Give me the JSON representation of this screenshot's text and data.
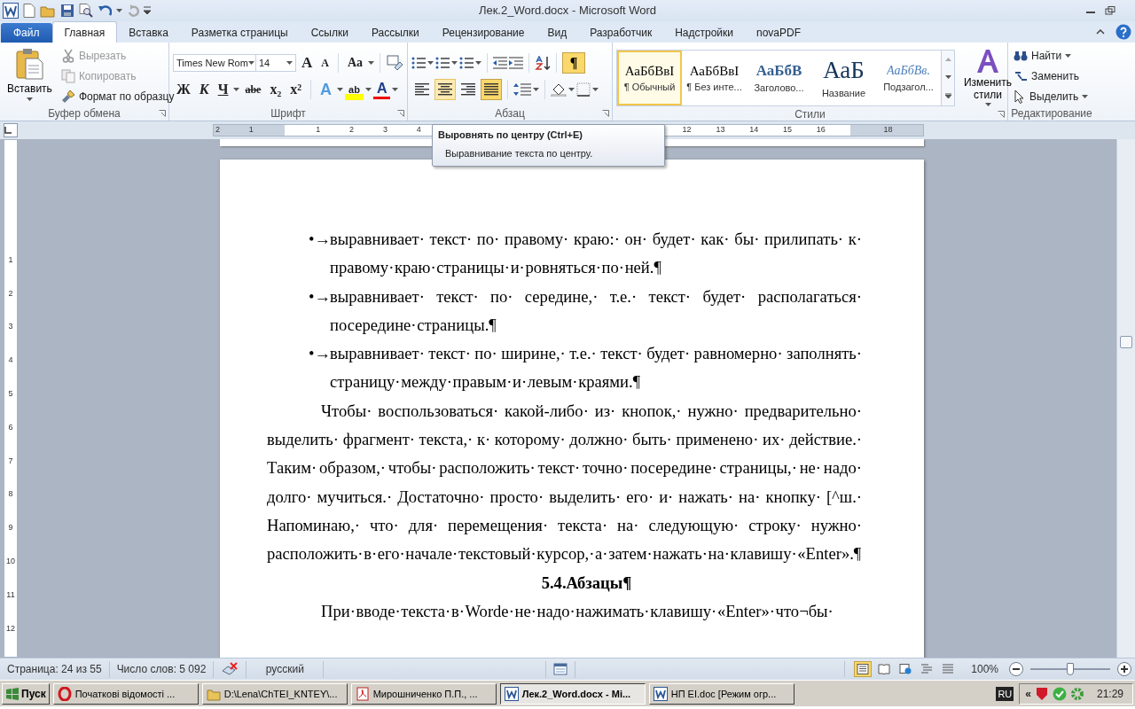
{
  "window": {
    "title": "Лек.2_Word.docx  -  Microsoft Word"
  },
  "tabs": [
    {
      "label": "Файл",
      "kind": "file",
      "selected": false
    },
    {
      "label": "Главная",
      "kind": "tab",
      "selected": true
    },
    {
      "label": "Вставка",
      "kind": "tab",
      "selected": false
    },
    {
      "label": "Разметка страницы",
      "kind": "tab",
      "selected": false
    },
    {
      "label": "Ссылки",
      "kind": "tab",
      "selected": false
    },
    {
      "label": "Рассылки",
      "kind": "tab",
      "selected": false
    },
    {
      "label": "Рецензирование",
      "kind": "tab",
      "selected": false
    },
    {
      "label": "Вид",
      "kind": "tab",
      "selected": false
    },
    {
      "label": "Разработчик",
      "kind": "tab",
      "selected": false
    },
    {
      "label": "Надстройки",
      "kind": "tab",
      "selected": false
    },
    {
      "label": "novaPDF",
      "kind": "tab",
      "selected": false
    }
  ],
  "clipboard": {
    "label": "Буфер обмена",
    "paste": "Вставить",
    "items": [
      {
        "kind": "cut",
        "label": "Вырезать",
        "disabled": true
      },
      {
        "kind": "copy",
        "label": "Копировать",
        "disabled": true
      },
      {
        "kind": "brush",
        "label": "Формат по образцу",
        "disabled": false
      }
    ]
  },
  "font": {
    "label": "Шрифт",
    "name": "Times New Rom",
    "size": "14",
    "grow": "A",
    "shrink": "A",
    "case": "Aa",
    "styles": [
      {
        "kind": "bold",
        "label": "Ж"
      },
      {
        "kind": "italic",
        "label": "К"
      },
      {
        "kind": "underline",
        "label": "Ч"
      },
      {
        "kind": "strike",
        "label": "abe"
      },
      {
        "kind": "sub",
        "label": "x₂"
      },
      {
        "kind": "sup",
        "label": "x²"
      }
    ],
    "effects": [
      {
        "kind": "text-effect",
        "label": "A"
      },
      {
        "kind": "highlight",
        "label": "ab"
      },
      {
        "kind": "font-color",
        "label": "A"
      }
    ]
  },
  "paragraph": {
    "label": "Абзац",
    "show_marks": {
      "label": "¶",
      "selected": true
    },
    "alignment": [
      {
        "kind": "left",
        "selected": false,
        "hovered": false
      },
      {
        "kind": "center",
        "selected": false,
        "hovered": true
      },
      {
        "kind": "right",
        "selected": false,
        "hovered": false
      },
      {
        "kind": "justify",
        "selected": true,
        "hovered": false
      }
    ]
  },
  "styles": {
    "label": "Стили",
    "items": [
      {
        "sample": "АаБбВвI",
        "label": "¶ Обычный",
        "kind": "normal",
        "selected": true
      },
      {
        "sample": "АаБбВвI",
        "label": "¶ Без инте...",
        "kind": "normal",
        "selected": false
      },
      {
        "sample": "АаБбВ",
        "label": "Заголово...",
        "kind": "heading",
        "selected": false
      },
      {
        "sample": "АаБ",
        "label": "Название",
        "kind": "title",
        "selected": false
      },
      {
        "sample": "АаБбВв.",
        "label": "Подзагол...",
        "kind": "subtitle",
        "selected": false
      }
    ],
    "change": "Изменить стили"
  },
  "editing": {
    "label": "Редактирование",
    "items": [
      {
        "kind": "find",
        "label": "Найти"
      },
      {
        "kind": "replace",
        "label": "Заменить"
      },
      {
        "kind": "select",
        "label": "Выделить"
      }
    ]
  },
  "ruler": {
    "labels": [
      "2",
      "1",
      "1",
      "2",
      "3",
      "4",
      "12",
      "13",
      "14",
      "15",
      "16",
      "18"
    ],
    "vertical_labels": [
      "1",
      "2",
      "3",
      "4",
      "5",
      "6",
      "7",
      "8",
      "9",
      "10",
      "11",
      "12"
    ]
  },
  "tooltip": {
    "title": "Выровнять по центру (Ctrl+E)",
    "body": "Выравнивание текста по центру."
  },
  "document": {
    "paragraphs": [
      {
        "kind": "bullet",
        "marker": "•→",
        "text": "выравнивает· текст· по· правому· краю:· он· будет· как· бы· прилипать· к· правому· краю· страницы· и· ровняться· по· ней.¶"
      },
      {
        "kind": "bullet",
        "marker": "•→",
        "text": "выравнивает· текст· по· середине,· т.е.· текст· будет· располагаться· посередине· страницы.¶"
      },
      {
        "kind": "bullet",
        "marker": "•→",
        "text": "выравнивает· текст· по· ширине,· т.е.· текст· будет· равномерно· заполнять· страницу· между· правым· и· левым· краями.¶"
      },
      {
        "kind": "body",
        "text": "Чтобы· воспользоваться· какой-либо· из· кнопок,· нужно· предварительно· выделить· фрагмент· текста,· к· которому· должно· быть· применено· их· действие.· Таким· образом,· чтобы· расположить· текст· точно· посередине· страницы,· не· надо· долго· мучиться.· Достаточно· просто· выделить· его· и· нажать· на· кнопку· [^ш.· Напоминаю,· что· для· перемещения· текста· на· следующую· строку· нужно· расположить· в· его· начале· текстовый· курсор,· а· затем· нажать· на· клавишу· «Enter».¶"
      },
      {
        "kind": "heading",
        "text": "5.4.Абзацы¶"
      },
      {
        "kind": "body",
        "text": "При· вводе· текста· в· Worde· не· надо· нажимать· клавишу· «Enter»· что¬бы·"
      }
    ]
  },
  "status_bar": {
    "page": "Страница: 24 из 55",
    "words": "Число слов: 5 092",
    "language": "русский",
    "zoom": "100%",
    "level": 0.5,
    "views": [
      {
        "kind": "print",
        "selected": true
      },
      {
        "kind": "read",
        "selected": false
      },
      {
        "kind": "web",
        "selected": false
      },
      {
        "kind": "outline",
        "selected": false
      },
      {
        "kind": "draft",
        "selected": false
      }
    ]
  },
  "taskbar": {
    "start": "Пуск",
    "tasks": [
      {
        "kind": "browser",
        "label": "Початкові відомості ...",
        "selected": false
      },
      {
        "kind": "folder",
        "label": "D:\\Lena\\ChTEI_KNTEY\\...",
        "selected": false
      },
      {
        "kind": "pdf",
        "label": "Мирошниченко П.П., ...",
        "selected": false
      },
      {
        "kind": "word",
        "label": "Лек.2_Word.docx - Mi...",
        "selected": true
      },
      {
        "kind": "word",
        "label": "НП EI.doc [Режим огр...",
        "selected": false
      }
    ],
    "language": "RU",
    "expand": "«",
    "clock": "21:29"
  }
}
